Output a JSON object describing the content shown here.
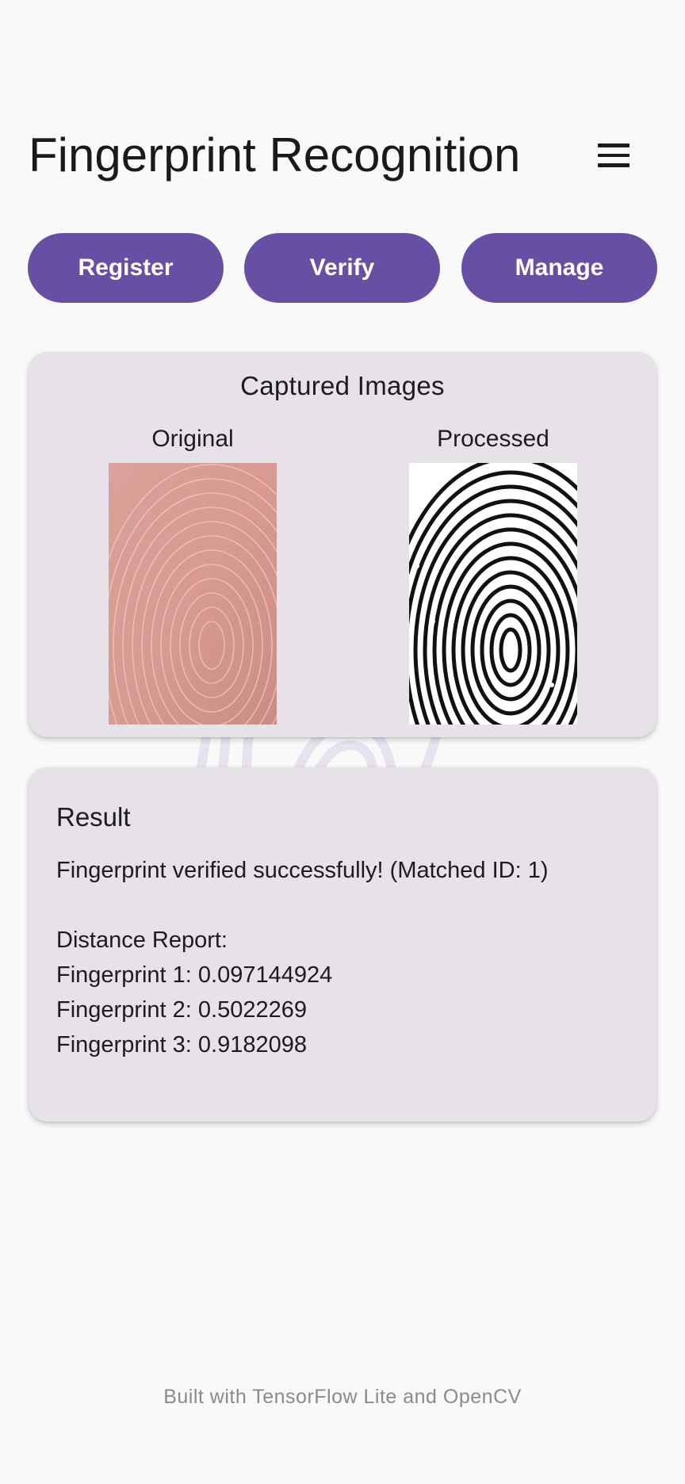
{
  "header": {
    "title": "Fingerprint Recognition",
    "menu_icon": "hamburger-menu-icon"
  },
  "actions": {
    "register_label": "Register",
    "verify_label": "Verify",
    "manage_label": "Manage",
    "button_color": "#6750a4"
  },
  "captured": {
    "title": "Captured Images",
    "original_label": "Original",
    "processed_label": "Processed"
  },
  "result": {
    "title": "Result",
    "message": "Fingerprint verified successfully! (Matched ID: 1)",
    "report_heading": "Distance Report:",
    "lines": [
      "Fingerprint 1: 0.097144924",
      "Fingerprint 2: 0.5022269",
      "Fingerprint 3: 0.9182098"
    ]
  },
  "footer": {
    "text": "Built with TensorFlow Lite and OpenCV"
  }
}
